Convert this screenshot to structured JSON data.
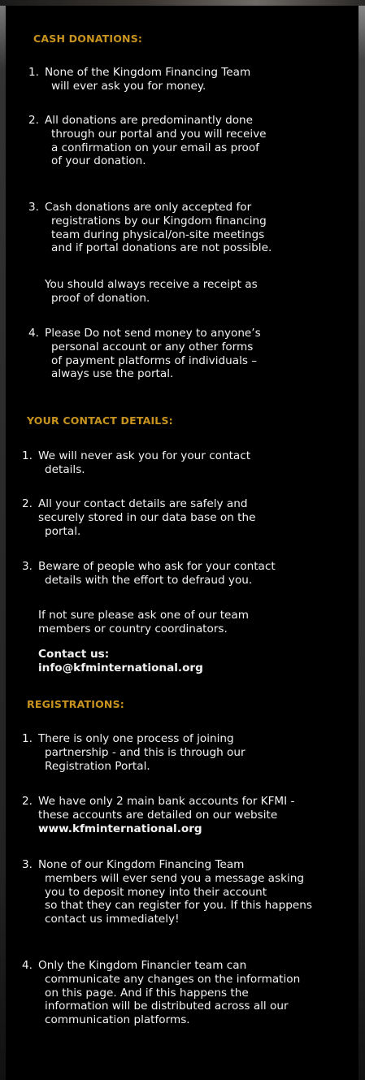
{
  "sections": [
    {
      "heading": "CASH DONATIONS:",
      "items": [
        {
          "num": "1.",
          "lines": [
            "None of the Kingdom Financing Team",
            "will ever ask you for money."
          ]
        },
        {
          "num": "2.",
          "lines": [
            "All donations are predominantly done",
            "through our portal and you will receive",
            "a confirmation on your email as proof",
            "of your donation."
          ]
        },
        {
          "num": "3.",
          "lines": [
            "Cash donations are only accepted for",
            "registrations by our Kingdom financing",
            "team during physical/on-site meetings",
            "and if portal donations are not possible."
          ]
        },
        {
          "num": "4.",
          "lines": [
            "Please Do not send money to anyone’s",
            "personal account or any other forms",
            "of payment platforms of individuals –",
            "always use the portal."
          ]
        }
      ],
      "note": [
        "You should always receive a receipt as",
        "proof of donation."
      ]
    },
    {
      "heading": "YOUR CONTACT DETAILS:",
      "items": [
        {
          "num": "1.",
          "lines": [
            "We will never ask you for your contact",
            "details."
          ]
        },
        {
          "num": "2.",
          "lines": [
            "All your contact details are safely and",
            "securely stored in our data base on the",
            "portal."
          ]
        },
        {
          "num": "3.",
          "lines": [
            "Beware of people who ask for your contact",
            "details with the effort to defraud you."
          ]
        }
      ],
      "note": [
        "If not sure please ask one of our team",
        "members or country coordinators."
      ],
      "contact_label": "Contact us:",
      "contact_email": "info@kfminternational.org"
    },
    {
      "heading": "REGISTRATIONS:",
      "items": [
        {
          "num": "1.",
          "lines": [
            "There is only one process of joining",
            "partnership - and this is through our",
            "Registration Portal."
          ]
        },
        {
          "num": "2.",
          "lines": [
            "We have only 2 main bank accounts for KFMI -",
            "these accounts are detailed on our website"
          ],
          "bold_line": "www.kfminternational.org"
        },
        {
          "num": "3.",
          "lines": [
            "None of our Kingdom Financing Team",
            "members will ever send you a message asking",
            "you to deposit money into their account",
            "so that they can register for you. If this happens",
            "contact us immediately!"
          ]
        },
        {
          "num": "4.",
          "lines": [
            "Only the Kingdom Financier team can",
            "communicate any changes on the information",
            "on this page. And if this happens the",
            "information will be distributed across all our",
            "communication platforms."
          ]
        }
      ]
    }
  ],
  "colors": {
    "heading": "#c8941f",
    "background": "#000000",
    "text": "#f2f2f2"
  }
}
